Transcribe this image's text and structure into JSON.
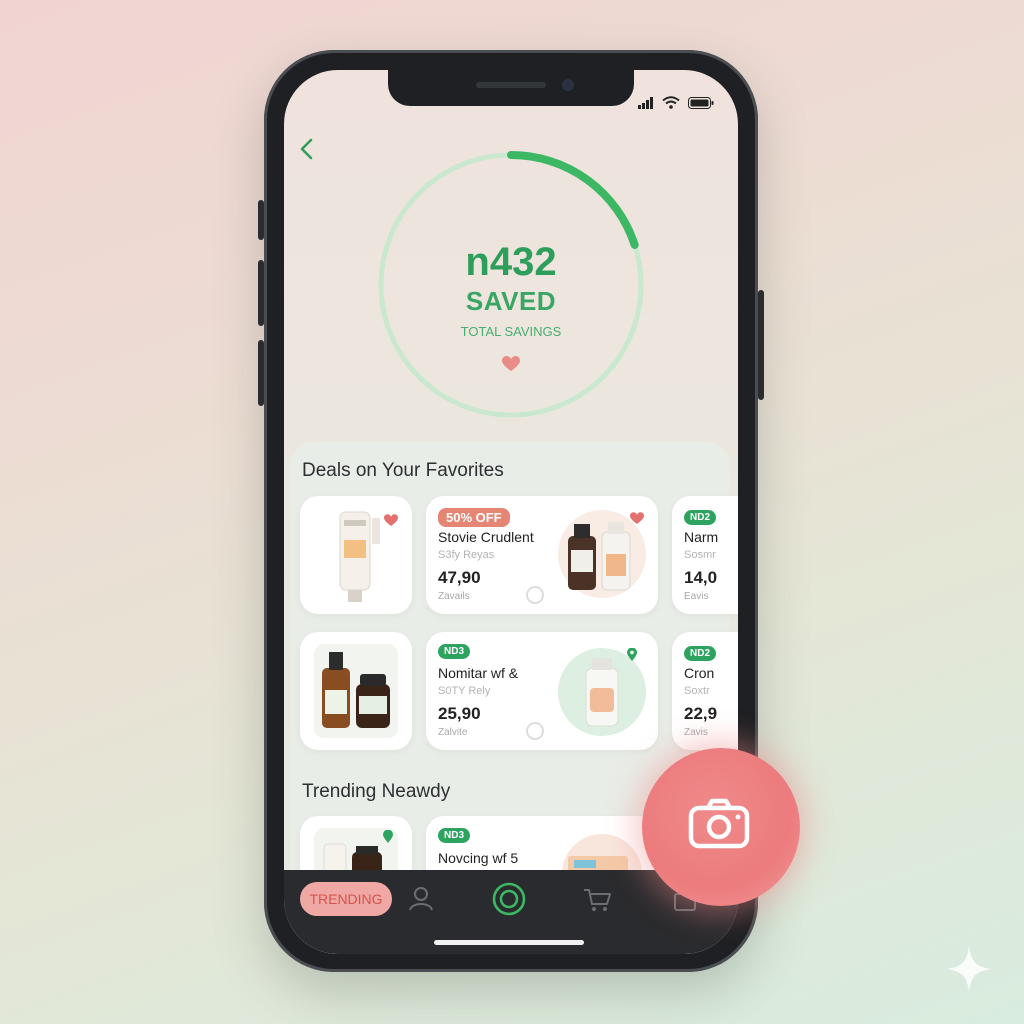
{
  "savings": {
    "amount": "n432",
    "saved_label": "SAVED",
    "total_label": "TOTAL SAVINGS",
    "progress": 0.2
  },
  "deals": {
    "title": "Deals on Your Favorites",
    "cards": [
      {
        "badge": "",
        "name": "",
        "sub": "",
        "price": "",
        "store": ""
      },
      {
        "badge": "50% OFF",
        "name": "Stovie Crudlent",
        "sub": "S3fy Reyas",
        "price": "47,90",
        "store": "Zavails"
      },
      {
        "badge": "ND2",
        "name": "Narm",
        "sub": "Sosmr",
        "price": "14,0",
        "store": "Eavis"
      },
      {
        "badge": "",
        "name": "",
        "sub": "",
        "price": "",
        "store": ""
      },
      {
        "badge": "ND3",
        "name": "Nomitar wf &",
        "sub": "S0TY Rely",
        "price": "25,90",
        "store": "Zalvite"
      },
      {
        "badge": "ND2",
        "name": "Cron",
        "sub": "Soxtr",
        "price": "22,9",
        "store": "Zavis"
      }
    ]
  },
  "trending": {
    "title": "Trending Neawdy",
    "cards": [
      {
        "badge": "ND3",
        "name": "Novcing wf 5"
      }
    ]
  },
  "nav": {
    "trending_label": "TRENDING"
  },
  "colors": {
    "accent_green": "#2e9e5b",
    "accent_pink": "#ec7b7d",
    "nav_bg": "#2a2b2e"
  },
  "icons": [
    "back-icon",
    "heart-icon",
    "camera-icon",
    "user-icon",
    "cart-icon",
    "scan-icon",
    "wifi-icon",
    "battery-icon",
    "signal-icon"
  ]
}
